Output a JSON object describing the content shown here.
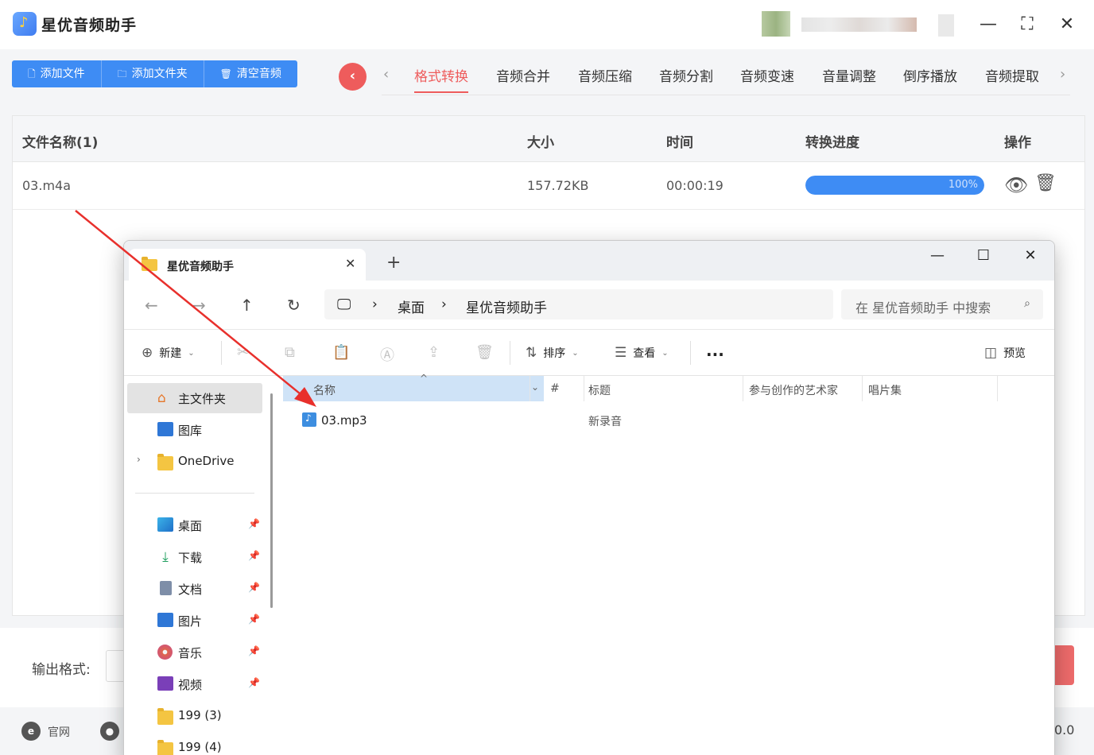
{
  "app": {
    "title": "星优音频助手",
    "toolbar": [
      {
        "label": "添加文件",
        "icon": "file-icon"
      },
      {
        "label": "添加文件夹",
        "icon": "folder-icon"
      },
      {
        "label": "清空音频",
        "icon": "trash-icon"
      }
    ],
    "tabs": [
      {
        "label": "格式转换",
        "active": true
      },
      {
        "label": "音频合并",
        "active": false
      },
      {
        "label": "音频压缩",
        "active": false
      },
      {
        "label": "音频分割",
        "active": false
      },
      {
        "label": "音频变速",
        "active": false
      },
      {
        "label": "音量调整",
        "active": false
      },
      {
        "label": "倒序播放",
        "active": false
      },
      {
        "label": "音频提取",
        "active": false
      }
    ],
    "table": {
      "headers": {
        "name": "文件名称(1)",
        "size": "大小",
        "time": "时间",
        "progress": "转换进度",
        "action": "操作"
      },
      "rows": [
        {
          "name": "03.m4a",
          "size": "157.72KB",
          "time": "00:00:19",
          "progress": 1.0,
          "progress_label": "100%"
        }
      ]
    },
    "footer": {
      "output_label": "输出格式:",
      "website_label": "官网",
      "version_fragment": "0.0"
    },
    "colors": {
      "accent": "#3e8cf4",
      "active_tab": "#ee5c5c"
    }
  },
  "explorer": {
    "tab_title": "星优音频助手",
    "breadcrumb": [
      "桌面",
      "星优音频助手"
    ],
    "search_placeholder": "在 星优音频助手 中搜索",
    "commands": {
      "new": "新建",
      "sort": "排序",
      "view": "查看",
      "more": "...",
      "preview": "预览"
    },
    "nav": {
      "home": "主文件夹",
      "gallery": "图库",
      "onedrive": "OneDrive",
      "pinned": [
        {
          "label": "桌面",
          "icon": "desktop-icon"
        },
        {
          "label": "下载",
          "icon": "download-icon"
        },
        {
          "label": "文档",
          "icon": "document-icon"
        },
        {
          "label": "图片",
          "icon": "pictures-icon"
        },
        {
          "label": "音乐",
          "icon": "music-icon"
        },
        {
          "label": "视频",
          "icon": "video-icon"
        }
      ],
      "folders": [
        "199 (3)",
        "199 (4)"
      ]
    },
    "columns": {
      "name": "名称",
      "number": "#",
      "title": "标题",
      "artist": "参与创作的艺术家",
      "album": "唱片集"
    },
    "files": [
      {
        "name": "03.mp3",
        "title": "新录音"
      }
    ]
  }
}
